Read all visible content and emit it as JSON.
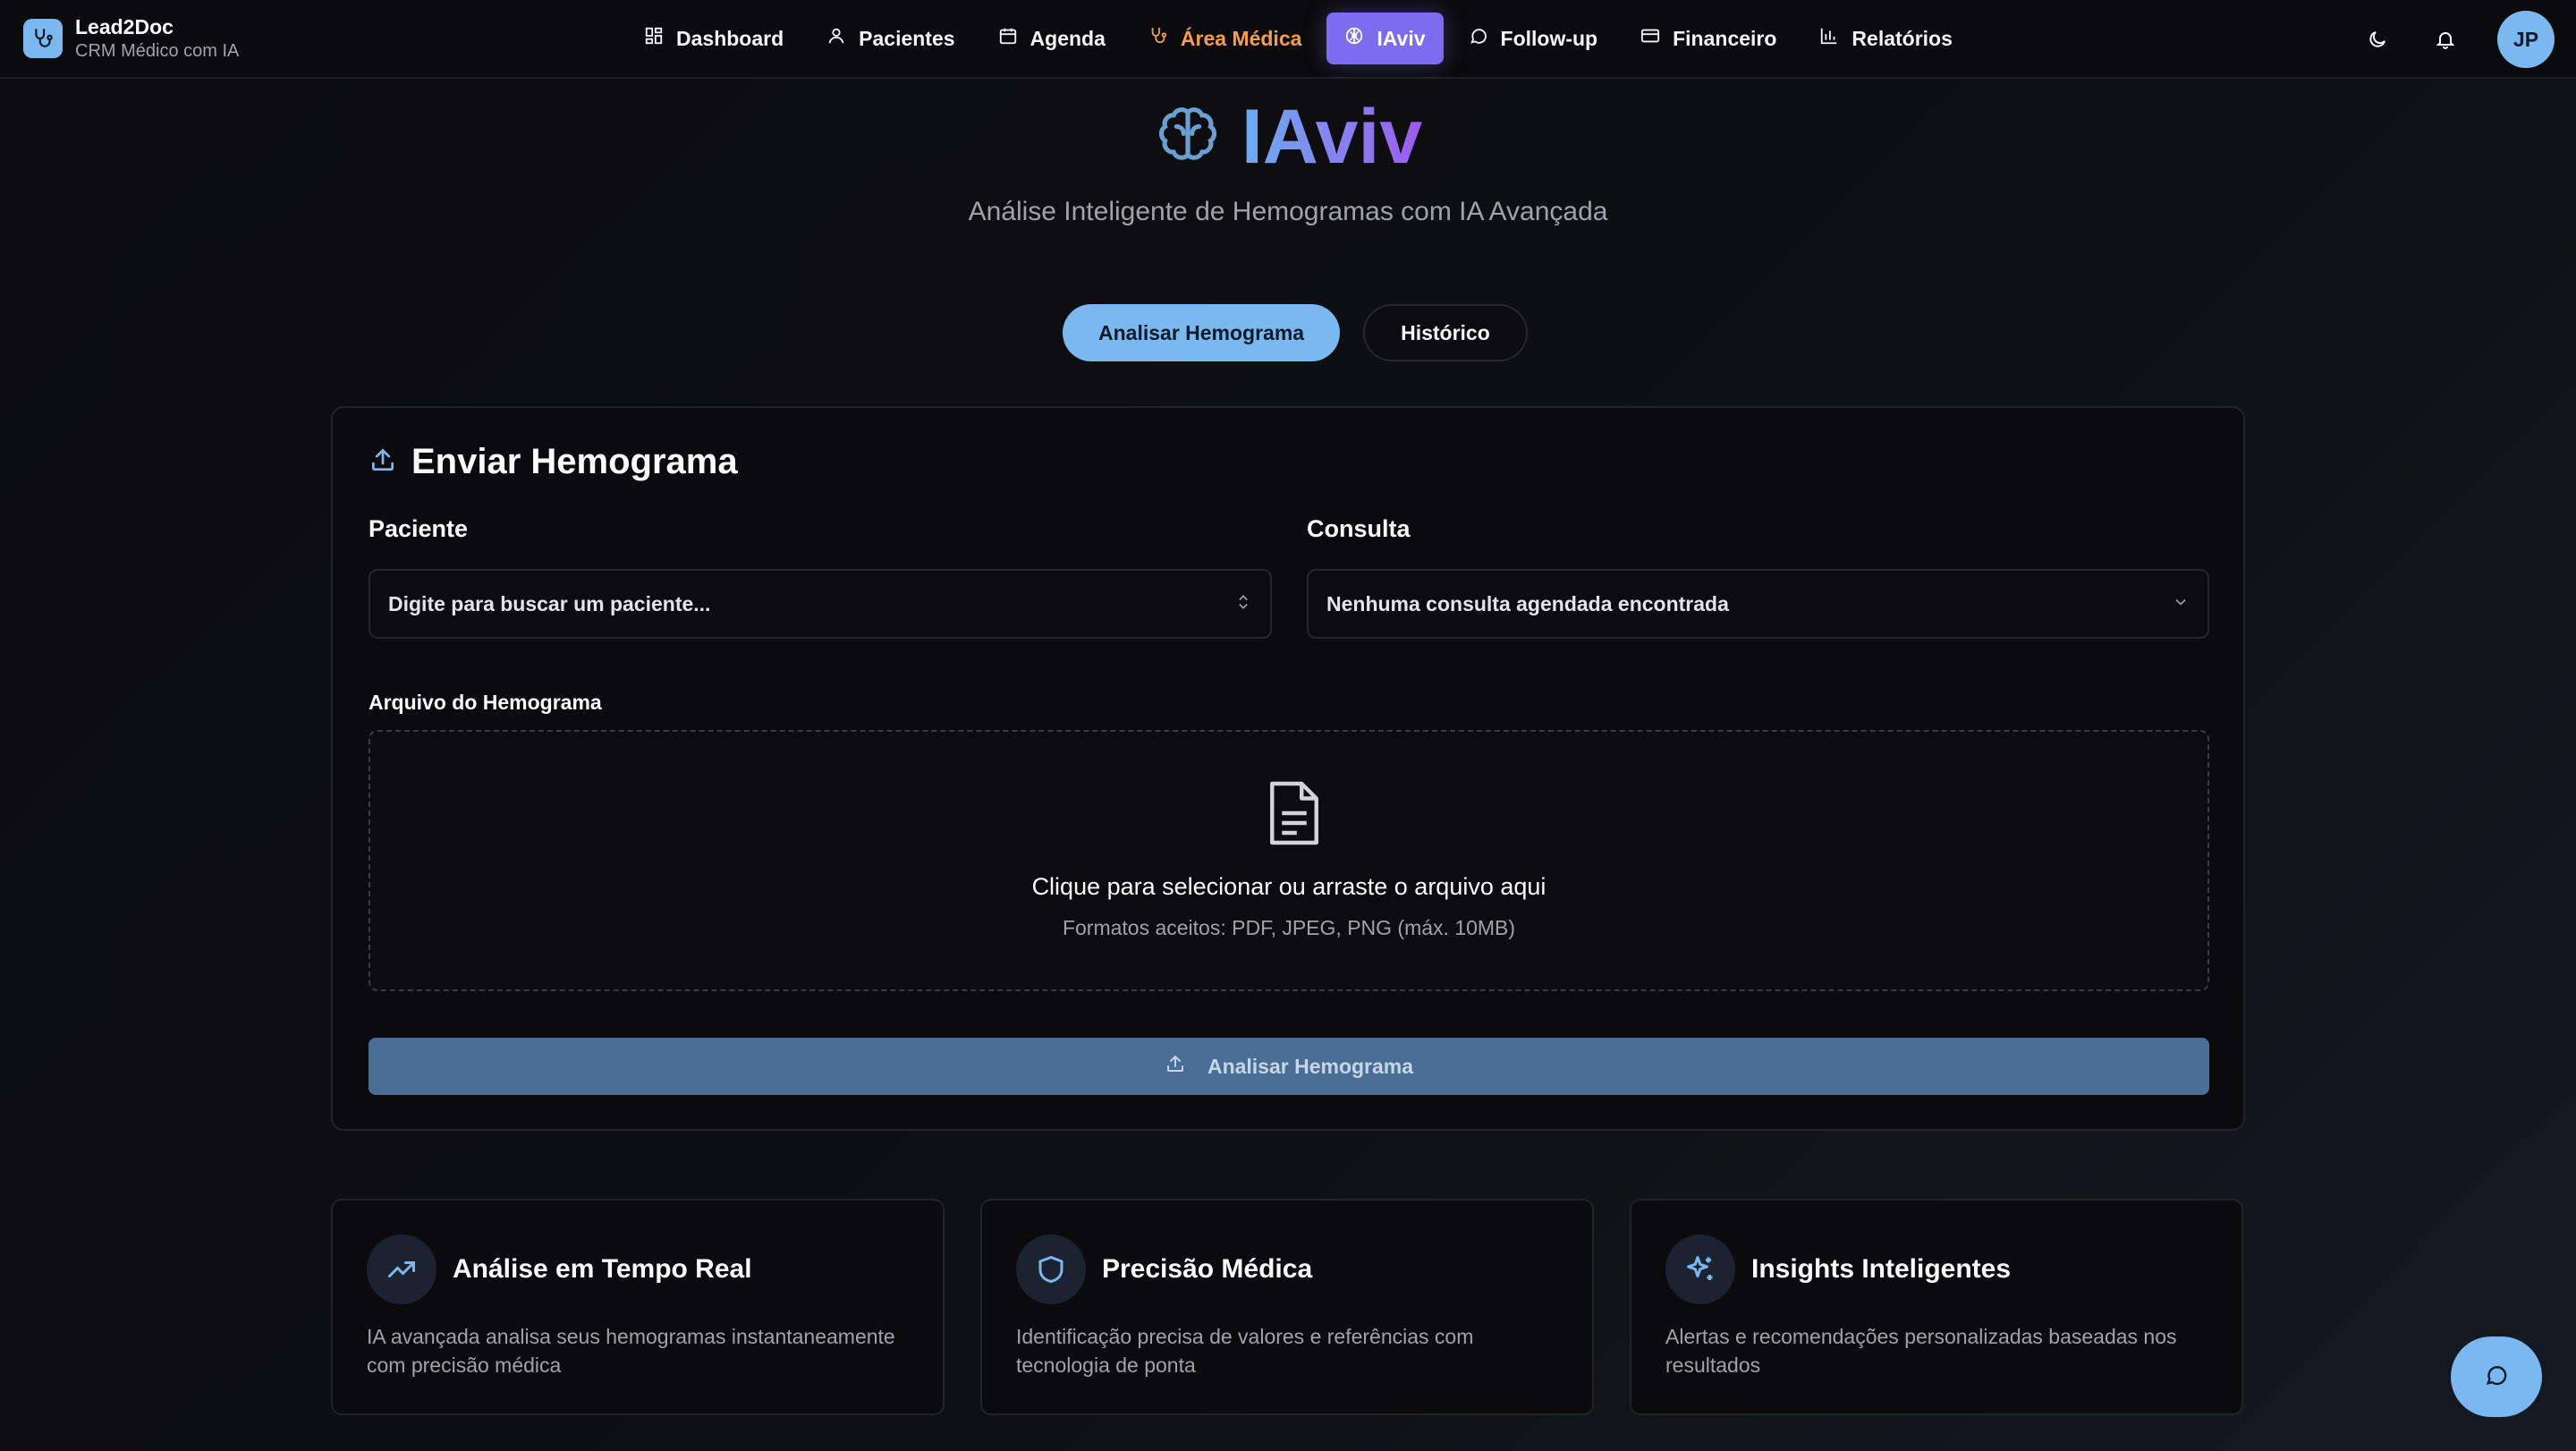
{
  "brand": {
    "name": "Lead2Doc",
    "subtitle": "CRM Médico com IA"
  },
  "nav": {
    "items": [
      {
        "label": "Dashboard",
        "icon": "dashboard-icon"
      },
      {
        "label": "Pacientes",
        "icon": "user-icon"
      },
      {
        "label": "Agenda",
        "icon": "calendar-icon"
      },
      {
        "label": "Área Médica",
        "icon": "stethoscope-icon"
      },
      {
        "label": "IAviv",
        "icon": "brain-icon",
        "active": true
      },
      {
        "label": "Follow-up",
        "icon": "chat-icon"
      },
      {
        "label": "Financeiro",
        "icon": "credit-card-icon"
      },
      {
        "label": "Relatórios",
        "icon": "bar-chart-icon"
      }
    ]
  },
  "user": {
    "initials": "JP"
  },
  "hero": {
    "title": "IAviv",
    "subtitle": "Análise Inteligente de Hemogramas com IA Avançada"
  },
  "tabs": {
    "analyze": "Analisar Hemograma",
    "history": "Histórico"
  },
  "upload_card": {
    "title": "Enviar Hemograma",
    "patient_label": "Paciente",
    "patient_placeholder": "Digite para buscar um paciente...",
    "consult_label": "Consulta",
    "consult_value": "Nenhuma consulta agendada encontrada",
    "file_label": "Arquivo do Hemograma",
    "dropzone_main": "Clique para selecionar ou arraste o arquivo aqui",
    "dropzone_formats": "Formatos aceitos: PDF, JPEG, PNG (máx. 10MB)",
    "submit_label": "Analisar Hemograma"
  },
  "features": [
    {
      "title": "Análise em Tempo Real",
      "description": "IA avançada analisa seus hemogramas instantaneamente com precisão médica",
      "icon": "trending-up-icon"
    },
    {
      "title": "Precisão Médica",
      "description": "Identificação precisa de valores e referências com tecnologia de ponta",
      "icon": "shield-icon"
    },
    {
      "title": "Insights Inteligentes",
      "description": "Alertas e recomendações personalizadas baseadas nos resultados",
      "icon": "sparkles-icon"
    }
  ],
  "colors": {
    "accent": "#7cb8f0",
    "active_nav": "#7c6cf0",
    "medica": "#f59e4a",
    "submit_disabled": "#4a6d95"
  }
}
